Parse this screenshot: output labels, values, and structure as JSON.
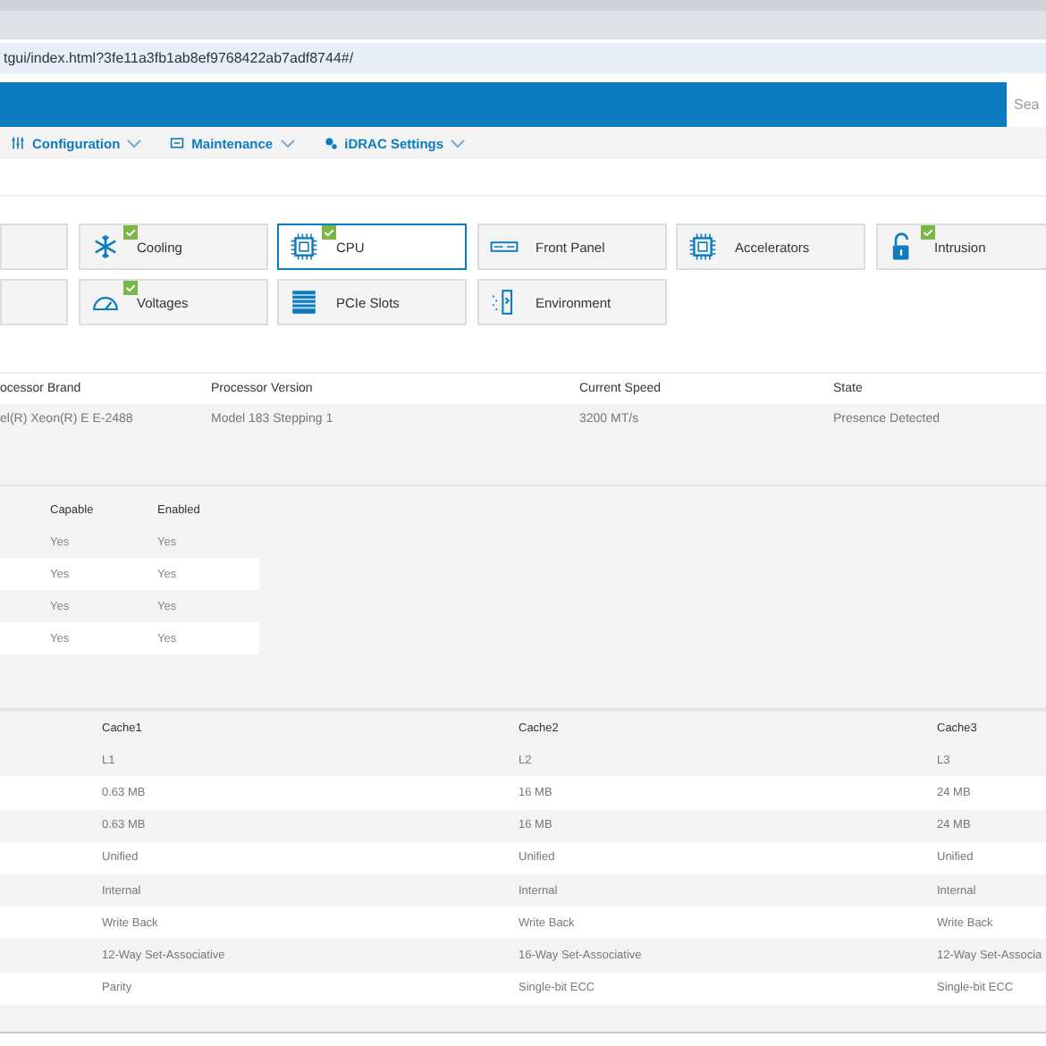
{
  "browser": {
    "url": "tgui/index.html?3fe11a3fb1ab8ef9768422ab7adf8744#/"
  },
  "header": {
    "search": {
      "placeholder": "Sea"
    }
  },
  "nav": [
    {
      "label": "Configuration",
      "kind": "config"
    },
    {
      "label": "Maintenance",
      "kind": "maintenance"
    },
    {
      "label": "iDRAC Settings",
      "kind": "settings"
    }
  ],
  "tiles": [
    {
      "kind": "blank",
      "selected": false
    },
    {
      "label": "Cooling",
      "kind": "cooling",
      "healthy": true,
      "selected": false
    },
    {
      "label": "CPU",
      "kind": "cpu",
      "healthy": true,
      "selected": true
    },
    {
      "label": "Front Panel",
      "kind": "panel",
      "healthy": false,
      "selected": false
    },
    {
      "label": "Accelerators",
      "kind": "cpu",
      "healthy": false,
      "selected": false
    },
    {
      "label": "Intrusion",
      "kind": "lock",
      "healthy": true,
      "selected": false
    },
    {
      "kind": "blank",
      "selected": false
    },
    {
      "label": "Voltages",
      "kind": "gauge",
      "healthy": true,
      "selected": false
    },
    {
      "label": "PCIe Slots",
      "kind": "slots",
      "healthy": false,
      "selected": false
    },
    {
      "label": "Environment",
      "kind": "environment",
      "healthy": false,
      "selected": false
    }
  ],
  "processor_table": {
    "columns": [
      "ocessor Brand",
      "Processor Version",
      "Current Speed",
      "State"
    ],
    "rows": [
      [
        "el(R) Xeon(R) E E-2488",
        "Model 183 Stepping 1",
        "3200 MT/s",
        "Presence Detected"
      ]
    ]
  },
  "capability_table": {
    "columns": [
      "Capable",
      "Enabled"
    ],
    "rows": [
      [
        "Yes",
        "Yes"
      ],
      [
        "Yes",
        "Yes"
      ],
      [
        "Yes",
        "Yes"
      ],
      [
        "Yes",
        "Yes"
      ]
    ]
  },
  "cache_table": {
    "columns": [
      "Cache1",
      "Cache2",
      "Cache3"
    ],
    "rows": [
      [
        "L1",
        "L2",
        "L3"
      ],
      [
        "0.63 MB",
        "16 MB",
        "24 MB"
      ],
      [
        "0.63 MB",
        "16 MB",
        "24 MB"
      ],
      [
        "Unified",
        "Unified",
        "Unified"
      ],
      [
        "Internal",
        "Internal",
        "Internal"
      ],
      [
        "Write Back",
        "Write Back",
        "Write Back"
      ],
      [
        "12-Way Set-Associative",
        "16-Way Set-Associative",
        "12-Way Set-Associa"
      ],
      [
        "Parity",
        "Single-bit ECC",
        "Single-bit ECC"
      ]
    ]
  }
}
